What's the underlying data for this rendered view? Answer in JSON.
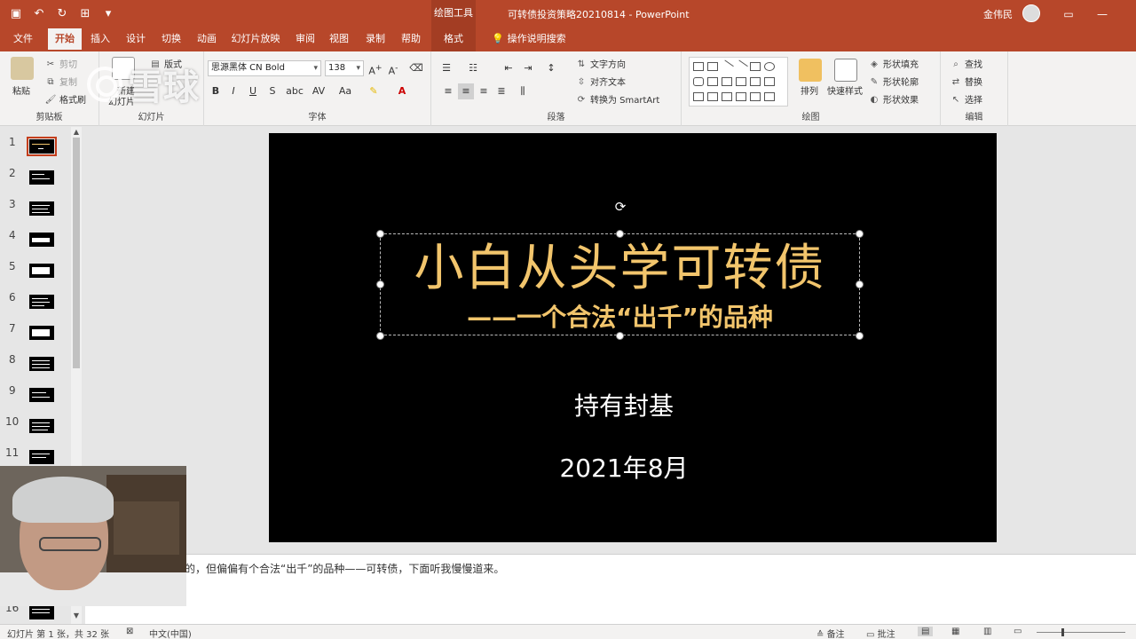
{
  "titlebar": {
    "context_tool": "绘图工具",
    "doc_title": "可转债投资策略20210814 - PowerPoint",
    "user": "金伟民"
  },
  "tabs": [
    {
      "label": "文件",
      "active": false
    },
    {
      "label": "开始",
      "active": true
    },
    {
      "label": "插入",
      "active": false
    },
    {
      "label": "设计",
      "active": false
    },
    {
      "label": "切换",
      "active": false
    },
    {
      "label": "动画",
      "active": false
    },
    {
      "label": "幻灯片放映",
      "active": false
    },
    {
      "label": "审阅",
      "active": false
    },
    {
      "label": "视图",
      "active": false
    },
    {
      "label": "录制",
      "active": false
    },
    {
      "label": "帮助",
      "active": false
    },
    {
      "label": "格式",
      "active": false
    }
  ],
  "tell_me": "操作说明搜索",
  "ribbon": {
    "clipboard": {
      "label": "剪贴板",
      "paste": "粘贴",
      "cut": "剪切",
      "copy": "复制",
      "format_painter": "格式刷"
    },
    "slides": {
      "label": "幻灯片",
      "new_slide": "新建",
      "new_slide2": "幻灯片",
      "layout": "版式"
    },
    "font": {
      "label": "字体",
      "font_name": "思源黑体 CN Bold",
      "font_size": "138"
    },
    "paragraph": {
      "label": "段落",
      "text_direction": "文字方向",
      "align_text": "对齐文本",
      "smartart": "转换为 SmartArt"
    },
    "drawing": {
      "label": "绘图",
      "arrange": "排列",
      "quick_styles": "快速样式",
      "shape_fill": "形状填充",
      "shape_outline": "形状轮廓",
      "shape_effects": "形状效果"
    },
    "editing": {
      "label": "编辑",
      "find": "查找",
      "replace": "替换",
      "select": "选择"
    }
  },
  "watermark": "雪球",
  "thumbnails": [
    {
      "num": "1",
      "active": true
    },
    {
      "num": "2",
      "active": false
    },
    {
      "num": "3",
      "active": false
    },
    {
      "num": "4",
      "active": false
    },
    {
      "num": "5",
      "active": false
    },
    {
      "num": "6",
      "active": false
    },
    {
      "num": "7",
      "active": false
    },
    {
      "num": "8",
      "active": false
    },
    {
      "num": "9",
      "active": false
    },
    {
      "num": "10",
      "active": false
    },
    {
      "num": "11",
      "active": false
    },
    {
      "num": "16",
      "active": false
    }
  ],
  "slide": {
    "title": "小白从头学可转债",
    "subtitle": "——一个合法“出千”的品种",
    "author": "持有封基",
    "date": "2021年8月"
  },
  "notes": "的，但偏偏有个合法“出千”的品种——可转债，下面听我慢慢道来。",
  "status": {
    "slide_info": "幻灯片 第 1 张，共 32 张",
    "language": "中文(中国)",
    "notes_btn": "备注",
    "comments_btn": "批注"
  },
  "colors": {
    "accent": "#b7472a",
    "title_gold": "#f2c56c"
  }
}
